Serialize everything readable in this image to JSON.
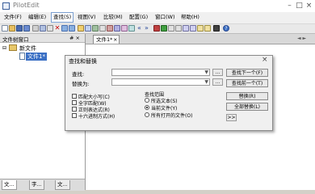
{
  "window": {
    "title": "PilotEdit"
  },
  "menu": [
    {
      "label": "文件(F)"
    },
    {
      "label": "编辑(E)"
    },
    {
      "label": "查找(S)"
    },
    {
      "label": "视图(V)"
    },
    {
      "label": "比较(M)"
    },
    {
      "label": "配置(G)"
    },
    {
      "label": "窗口(W)"
    },
    {
      "label": "帮助(H)"
    }
  ],
  "active_menu_index": 2,
  "left_panel": {
    "title": "文件树窗口",
    "pin": "# ×",
    "tree_root": "新文件",
    "tree_child": "文件1*",
    "bottom_tabs": [
      "文...",
      "字...",
      "文..."
    ]
  },
  "editor": {
    "tab_label": "文件1*",
    "tab_close": "×",
    "nav_arrows": "◄ ►"
  },
  "dialog": {
    "title": "查找和替换",
    "find_label": "查找:",
    "replace_label": "替换为:",
    "find_value": "",
    "replace_value": "",
    "browse": "...",
    "options": [
      "匹配大小写(C)",
      "全字匹配(W)",
      "正则表达式(R)",
      "十六进制方式(H)"
    ],
    "scope_title": "查找范围",
    "scope_options": [
      "所选文本(S)",
      "当前文件(Y)",
      "所有打开的文件(O)"
    ],
    "scope_selected": 1,
    "buttons": [
      "查找下一个(F)",
      "查找前一个(T)",
      "替换(R)",
      "全部替换(L)"
    ],
    "more": ">>"
  },
  "colors": {
    "accent": "#3a6fc4",
    "dialog_bg": "#f0f0f0",
    "panel_bg": "#ffffff"
  }
}
